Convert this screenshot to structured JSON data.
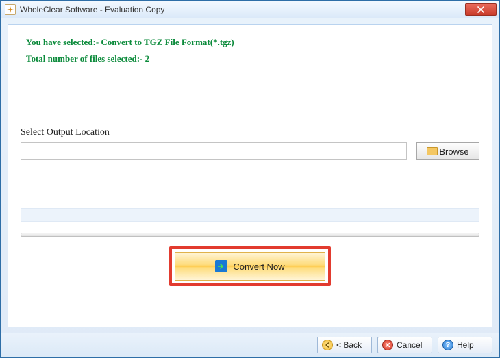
{
  "window": {
    "title": "WholeClear Software - Evaluation Copy"
  },
  "summary": {
    "line1": "You have selected:- Convert to TGZ File Format(*.tgz)",
    "line2": "Total number of files selected:- 2"
  },
  "output": {
    "label": "Select Output Location",
    "value": "",
    "browse_label": "Browse"
  },
  "convert": {
    "label": "Convert Now"
  },
  "footer": {
    "back": "< Back",
    "cancel": "Cancel",
    "help": "Help"
  }
}
